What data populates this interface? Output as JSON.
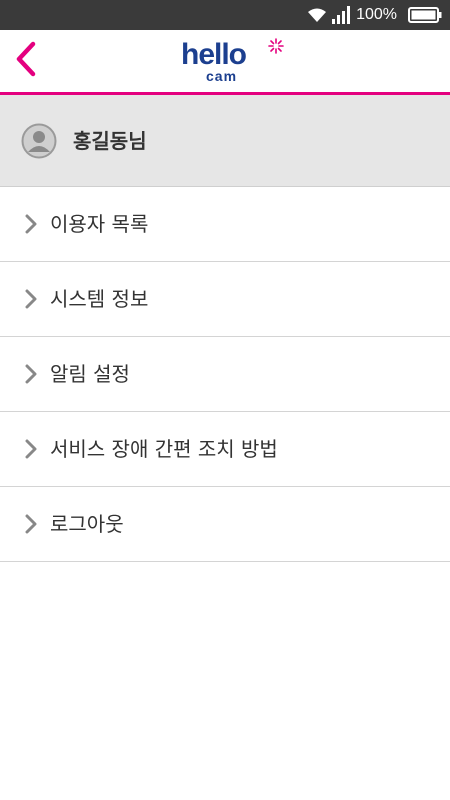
{
  "status_bar": {
    "battery_percent": "100%",
    "icons": [
      "wifi-icon",
      "signal-icon",
      "battery-icon"
    ]
  },
  "app_bar": {
    "logo_main": "hello",
    "logo_sub": "cam",
    "back_icon": "chevron-left-icon",
    "accent_color": "#e4007f",
    "brand_color": "#1c3f8f"
  },
  "profile": {
    "name": "홍길동님",
    "avatar_icon": "user-avatar-icon"
  },
  "menu": {
    "items": [
      {
        "label": "이용자 목록"
      },
      {
        "label": "시스템 정보"
      },
      {
        "label": "알림 설정"
      },
      {
        "label": "서비스 장애 간편 조치 방법"
      },
      {
        "label": "로그아웃"
      }
    ]
  }
}
